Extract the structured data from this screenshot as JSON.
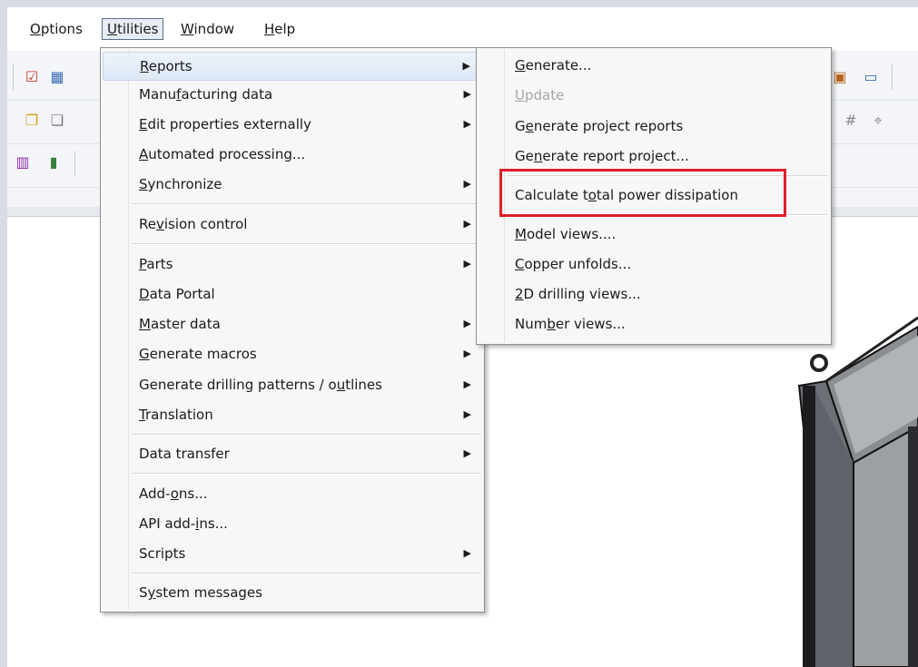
{
  "menubar": {
    "items": [
      {
        "pre": "",
        "u": "O",
        "post": "ptions"
      },
      {
        "pre": "",
        "u": "U",
        "post": "tilities"
      },
      {
        "pre": "",
        "u": "W",
        "post": "indow"
      },
      {
        "pre": "",
        "u": "H",
        "post": "elp"
      }
    ]
  },
  "utilities_menu": {
    "items": [
      {
        "pre": "",
        "u": "R",
        "post": "eports",
        "sub": true
      },
      {
        "pre": "Manu",
        "u": "f",
        "post": "acturing data",
        "sub": true
      },
      {
        "pre": "",
        "u": "E",
        "post": "dit properties externally",
        "sub": true
      },
      {
        "pre": "",
        "u": "A",
        "post": "utomated processing...",
        "sub": false
      },
      {
        "pre": "",
        "u": "S",
        "post": "ynchronize",
        "sub": true
      },
      {
        "pre": "Re",
        "u": "v",
        "post": "ision control",
        "sub": true
      },
      {
        "pre": "",
        "u": "P",
        "post": "arts",
        "sub": true
      },
      {
        "pre": "",
        "u": "D",
        "post": "ata Portal",
        "sub": false
      },
      {
        "pre": "",
        "u": "M",
        "post": "aster data",
        "sub": true
      },
      {
        "pre": "",
        "u": "G",
        "post": "enerate macros",
        "sub": true
      },
      {
        "pre": "Generate drilling patterns / o",
        "u": "u",
        "post": "tlines",
        "sub": true
      },
      {
        "pre": "",
        "u": "T",
        "post": "ranslation",
        "sub": true
      },
      {
        "pre": "Data transfer",
        "u": "",
        "post": "",
        "sub": true
      },
      {
        "pre": "Add-",
        "u": "o",
        "post": "ns...",
        "sub": false
      },
      {
        "pre": "API add-",
        "u": "i",
        "post": "ns...",
        "sub": false
      },
      {
        "pre": "Scripts",
        "u": "",
        "post": "",
        "sub": true
      },
      {
        "pre": "S",
        "u": "y",
        "post": "stem messages",
        "sub": false
      }
    ]
  },
  "reports_submenu": {
    "items": [
      {
        "pre": "",
        "u": "G",
        "post": "enerate...",
        "disabled": false
      },
      {
        "pre": "",
        "u": "U",
        "post": "pdate",
        "disabled": true
      },
      {
        "pre": "G",
        "u": "e",
        "post": "nerate project reports",
        "disabled": false
      },
      {
        "pre": "Ge",
        "u": "n",
        "post": "erate report project...",
        "disabled": false
      },
      {
        "pre": "Calculate t",
        "u": "o",
        "post": "tal power dissipation",
        "disabled": false
      },
      {
        "pre": "",
        "u": "M",
        "post": "odel views....",
        "disabled": false
      },
      {
        "pre": "",
        "u": "C",
        "post": "opper unfolds...",
        "disabled": false
      },
      {
        "pre": "",
        "u": "2",
        "post": "D drilling views...",
        "disabled": false
      },
      {
        "pre": "Num",
        "u": "b",
        "post": "er views...",
        "disabled": false
      }
    ]
  },
  "colors": {
    "highlight_box": "#e0202a",
    "menu_bg": "#f7f7f7"
  }
}
